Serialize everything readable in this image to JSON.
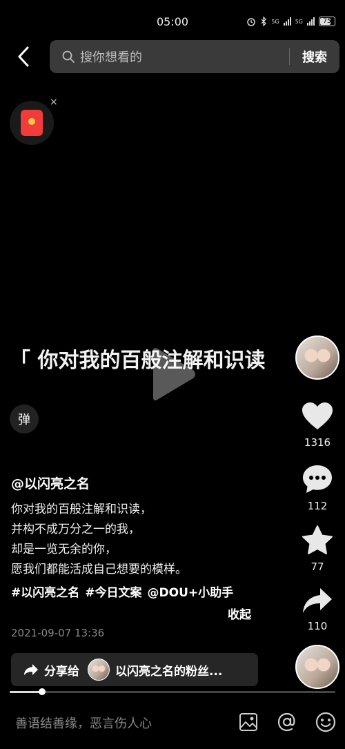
{
  "status_bar": {
    "time": "05:00",
    "network1": "5G",
    "network2": "5G",
    "battery": "75",
    "battery_level": 0.75
  },
  "search": {
    "placeholder": "搜你想看的",
    "button_label": "搜索"
  },
  "red_packet": {
    "close_label": "×"
  },
  "video": {
    "caption_text": "「 你对我的百般注解和识读",
    "danmaku_label": "弹"
  },
  "rail": {
    "likes": "1316",
    "comments": "112",
    "favorites": "77",
    "shares": "110"
  },
  "post": {
    "author": "@以闪亮之名",
    "lines": [
      "你对我的百般注解和识读，",
      "并构不成万分之一的我，",
      "却是一览无余的你，",
      "愿我们都能活成自己想要的模样。"
    ],
    "tags": [
      "#以闪亮之名",
      "#今日文案",
      "@DOU+小助手"
    ],
    "collapse_label": "收起",
    "date": "2021-09-07 13:36"
  },
  "share": {
    "label": "分享给",
    "target": "以闪亮之名的粉丝..."
  },
  "progress": {
    "fraction": 0.1
  },
  "comment_bar": {
    "placeholder": "善语结善缘，恶言伤人心"
  },
  "colors": {
    "background": "#000000",
    "search_bg": "#3a3a3a",
    "red_packet": "#f23b3b",
    "share_pill": "#262626"
  }
}
